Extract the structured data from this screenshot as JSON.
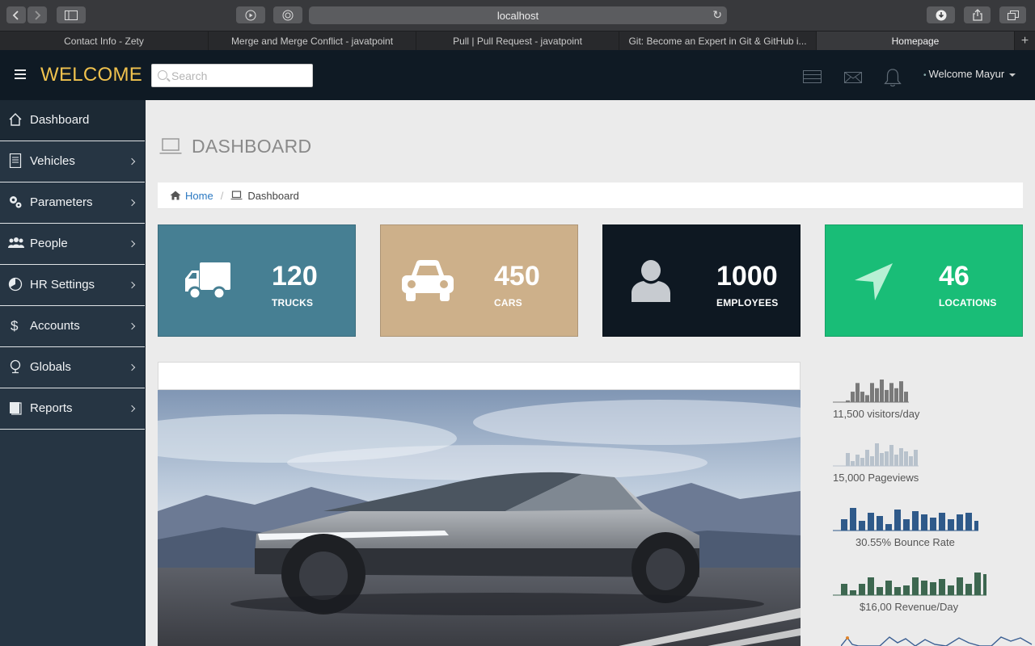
{
  "browser": {
    "url": "localhost",
    "tabs": [
      {
        "label": "Contact Info - Zety",
        "active": false
      },
      {
        "label": "Merge and Merge Conflict - javatpoint",
        "active": false
      },
      {
        "label": "Pull | Pull Request - javatpoint",
        "active": false
      },
      {
        "label": "Git: Become an Expert in Git & GitHub i...",
        "active": false
      },
      {
        "label": "Homepage",
        "active": true
      }
    ],
    "new_tab_label": "+"
  },
  "header": {
    "brand": "WELCOME",
    "search_placeholder": "Search",
    "user_label": "Welcome Mayur",
    "icons": [
      "list-icon",
      "mail-icon",
      "bell-icon"
    ]
  },
  "sidebar": {
    "items": [
      {
        "label": "Dashboard",
        "icon": "home-icon",
        "active": true,
        "has_chevron": false
      },
      {
        "label": "Vehicles",
        "icon": "document-icon",
        "active": false,
        "has_chevron": true
      },
      {
        "label": "Parameters",
        "icon": "gears-icon",
        "active": false,
        "has_chevron": true
      },
      {
        "label": "People",
        "icon": "people-icon",
        "active": false,
        "has_chevron": true
      },
      {
        "label": "HR Settings",
        "icon": "pie-chart-icon",
        "active": false,
        "has_chevron": true
      },
      {
        "label": "Accounts",
        "icon": "dollar-icon",
        "active": false,
        "has_chevron": true
      },
      {
        "label": "Globals",
        "icon": "globe-icon",
        "active": false,
        "has_chevron": true
      },
      {
        "label": "Reports",
        "icon": "book-icon",
        "active": false,
        "has_chevron": true
      }
    ]
  },
  "page": {
    "title": "DASHBOARD",
    "breadcrumb": {
      "home": "Home",
      "current": "Dashboard"
    }
  },
  "stats": [
    {
      "value": "120",
      "label": "TRUCKS",
      "color": "#467f93",
      "icon": "truck-icon"
    },
    {
      "value": "450",
      "label": "CARS",
      "color": "#cdb08a",
      "icon": "car-icon"
    },
    {
      "value": "1000",
      "label": "EMPLOYEES",
      "color": "#0e1822",
      "icon": "user-icon"
    },
    {
      "value": "46",
      "label": "LOCATIONS",
      "color": "#19bd77",
      "icon": "location-arrow-icon"
    }
  ],
  "sparklines": [
    {
      "label": "11,500 visitors/day",
      "color": "#7a7a7a",
      "values": [
        1,
        6,
        11,
        6,
        4,
        11,
        8,
        13,
        7,
        11,
        8,
        12,
        6
      ]
    },
    {
      "label": "15,000 Pageviews",
      "color": "#b8c2cc",
      "values": [
        8,
        3,
        7,
        5,
        10,
        6,
        14,
        8,
        9,
        13,
        7,
        11,
        9,
        6,
        10
      ]
    },
    {
      "label": "30.55% Bounce Rate",
      "color": "#2f5a8a",
      "values": [
        7,
        14,
        6,
        11,
        9,
        4,
        13,
        7,
        12,
        10,
        8,
        11,
        7,
        10,
        11,
        6,
        3
      ]
    },
    {
      "label": "$16,00 Revenue/Day",
      "color": "#3d6750",
      "values": [
        7,
        3,
        7,
        11,
        5,
        9,
        5,
        6,
        11,
        9,
        8,
        10,
        6,
        11,
        7,
        14,
        13
      ]
    }
  ],
  "hero_image": "cybertruck-photo"
}
